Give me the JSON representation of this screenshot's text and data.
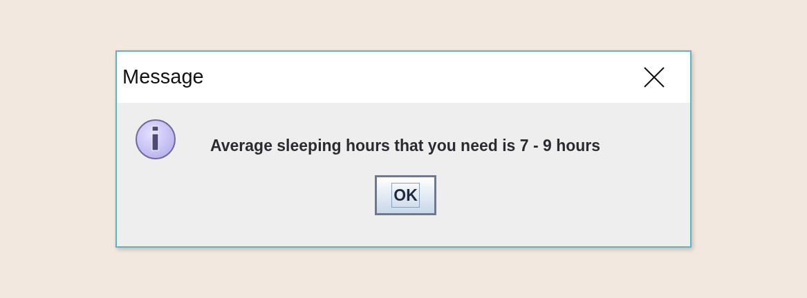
{
  "window": {
    "title": "Message"
  },
  "icon": {
    "kind": "information"
  },
  "message": "Average sleeping hours that you need is 7 - 9 hours",
  "buttons": [
    {
      "label": "OK",
      "focused": true
    }
  ]
}
